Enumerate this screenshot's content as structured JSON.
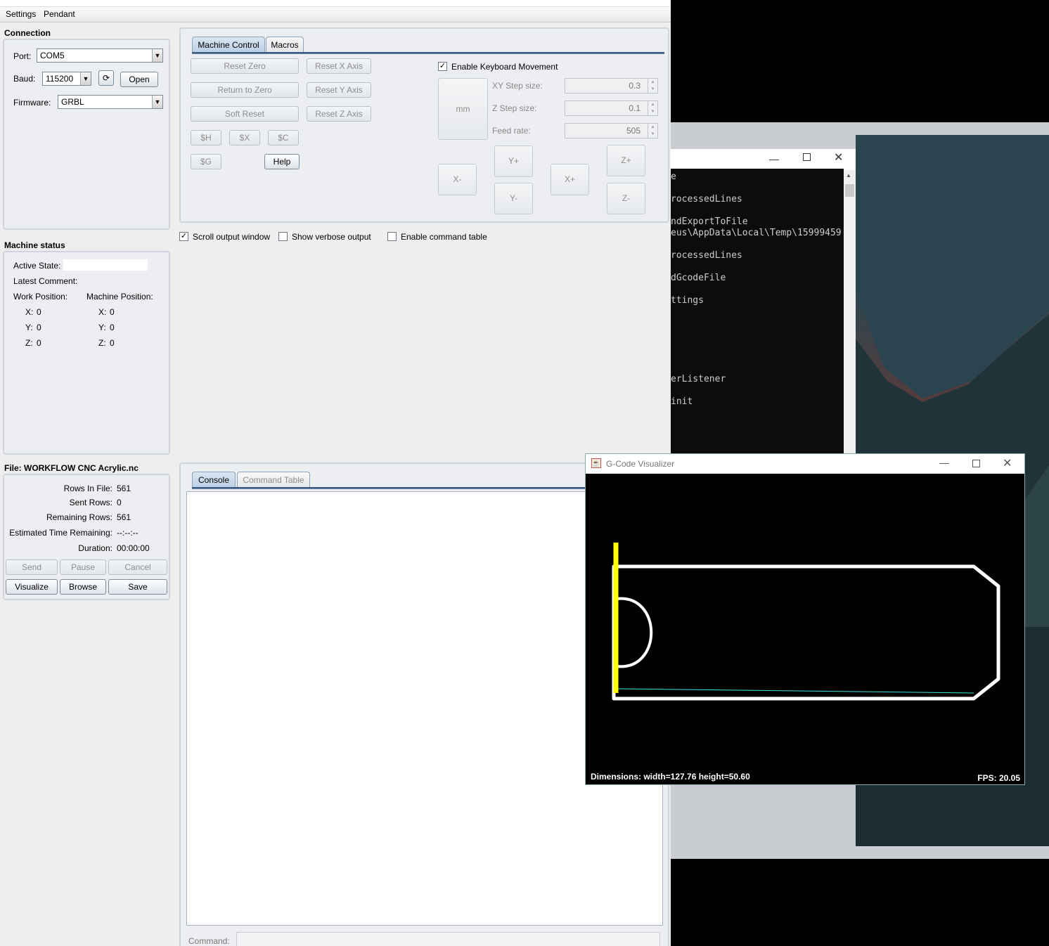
{
  "menu": [
    "Settings",
    "Pendant"
  ],
  "connection": {
    "title": "Connection",
    "port_label": "Port:",
    "port_value": "COM5",
    "baud_label": "Baud:",
    "baud_value": "115200",
    "open_label": "Open",
    "firmware_label": "Firmware:",
    "firmware_value": "GRBL"
  },
  "machine_status": {
    "title": "Machine status",
    "active_state_label": "Active State:",
    "latest_comment_label": "Latest Comment:",
    "work_position_label": "Work Position:",
    "machine_position_label": "Machine Position:",
    "work": {
      "x_label": "X:",
      "x": "0",
      "y_label": "Y:",
      "y": "0",
      "z_label": "Z:",
      "z": "0"
    },
    "machine": {
      "x_label": "X:",
      "x": "0",
      "y_label": "Y:",
      "y": "0",
      "z_label": "Z:",
      "z": "0"
    }
  },
  "file": {
    "title": "File: WORKFLOW CNC Acrylic.nc",
    "rows_in_file_label": "Rows In File:",
    "rows_in_file": "561",
    "sent_rows_label": "Sent Rows:",
    "sent_rows": "0",
    "remaining_rows_label": "Remaining Rows:",
    "remaining_rows": "561",
    "est_time_label": "Estimated Time Remaining:",
    "est_time": "--:--:--",
    "duration_label": "Duration:",
    "duration": "00:00:00",
    "send": "Send",
    "pause": "Pause",
    "cancel": "Cancel",
    "visualize": "Visualize",
    "browse": "Browse",
    "save": "Save"
  },
  "control_tabs": {
    "machine_control": "Machine Control",
    "macros": "Macros"
  },
  "controls": {
    "reset_zero": "Reset Zero",
    "reset_x": "Reset X Axis",
    "return_to_zero": "Return to Zero",
    "reset_y": "Reset Y Axis",
    "soft_reset": "Soft Reset",
    "reset_z": "Reset Z Axis",
    "h": "$H",
    "x": "$X",
    "c": "$C",
    "g": "$G",
    "help": "Help"
  },
  "keyboard": {
    "enable_label": "Enable Keyboard Movement",
    "enabled": true,
    "unit": "mm",
    "xy_step_label": "XY Step size:",
    "xy_step": "0.3",
    "z_step_label": "Z Step size:",
    "z_step": "0.1",
    "feed_label": "Feed rate:",
    "feed": "505",
    "y_plus": "Y+",
    "y_minus": "Y-",
    "x_minus": "X-",
    "x_plus": "X+",
    "z_plus": "Z+",
    "z_minus": "Z-"
  },
  "options": {
    "scroll_output": "Scroll output window",
    "scroll_checked": true,
    "verbose": "Show verbose output",
    "verbose_checked": false,
    "command_table": "Enable command table",
    "command_table_checked": false
  },
  "console_tabs": {
    "console": "Console",
    "command_table": "Command Table"
  },
  "command_label": "Command:",
  "terminal": {
    "lines": [
      "e",
      "rocessedLines",
      "ndExportToFile",
      "eus\\AppData\\Local\\Temp\\15999459",
      "rocessedLines",
      "dGcodeFile",
      "ttings",
      "erListener",
      "init"
    ]
  },
  "visualizer": {
    "title": "G-Code Visualizer",
    "dimensions": "Dimensions: width=127.76 height=50.60",
    "fps": "FPS: 20.05"
  },
  "colors": {
    "toolpath": "#ffffff",
    "tool": "#ffff00",
    "progress": "#40e0e0",
    "accent": "#3a5a80"
  }
}
